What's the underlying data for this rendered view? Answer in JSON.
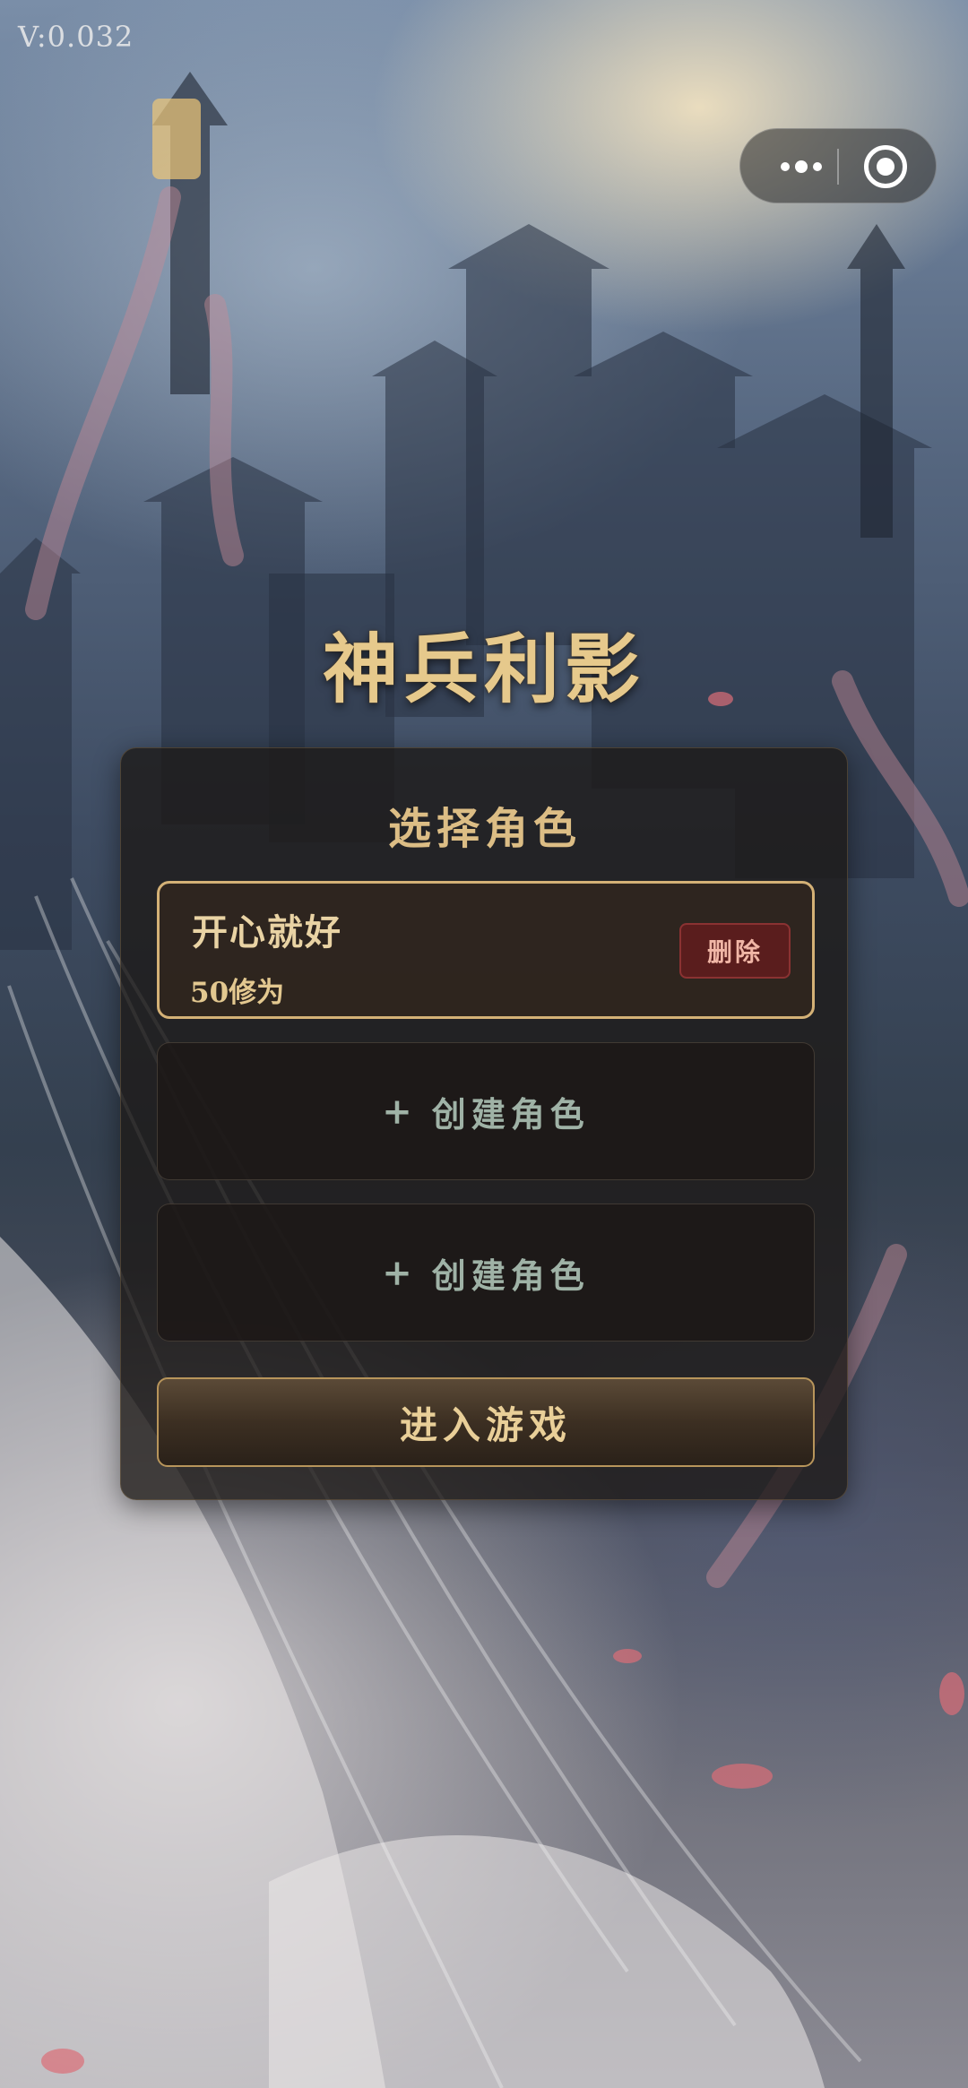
{
  "version": "V:0.032",
  "capsule": {
    "more_icon": "more-dots-icon",
    "close_icon": "target-circle-icon"
  },
  "game_title": "神兵利影",
  "panel": {
    "title": "选择角色",
    "characters": [
      {
        "name": "开心就好",
        "level": "50修为",
        "delete_label": "删除"
      }
    ],
    "empty_slots": [
      {
        "plus": "+",
        "label": "创建角色"
      },
      {
        "plus": "+",
        "label": "创建角色"
      }
    ],
    "enter_label": "进入游戏"
  },
  "colors": {
    "title_gold": "#e6c98c",
    "selected_border": "#d4b176",
    "delete_bg": "#5a1d1d",
    "create_text": "#9fb2a6"
  }
}
